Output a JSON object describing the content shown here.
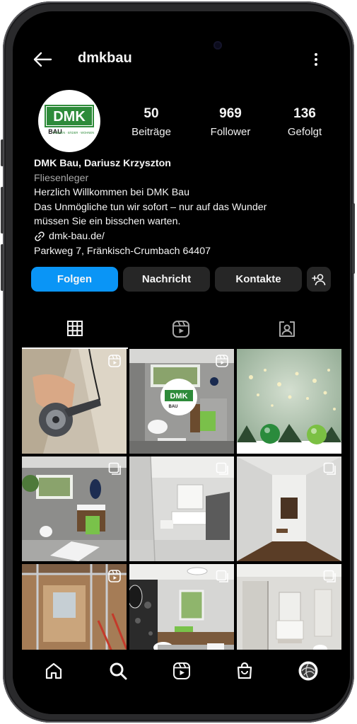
{
  "header": {
    "username": "dmkbau"
  },
  "avatar": {
    "logo_text": "DMK",
    "logo_subtext": "BAU",
    "logo_tagline": "FLIESEN · BÄDER · WOHNEN",
    "brand_color": "#2e8b3a"
  },
  "stats": [
    {
      "value": "50",
      "label": "Beiträge"
    },
    {
      "value": "969",
      "label": "Follower"
    },
    {
      "value": "136",
      "label": "Gefolgt"
    }
  ],
  "bio": {
    "name": "DMK Bau, Dariusz Krzyszton",
    "category": "Fliesenleger",
    "line1": "Herzlich Willkommen bei DMK Bau",
    "line2": "Das Unmögliche tun wir sofort – nur auf das Wunder",
    "line3": "müssen Sie ein bisschen warten.",
    "link": "dmk-bau.de/",
    "address": "Parkweg 7, Fränkisch-Crumbach 64407"
  },
  "buttons": {
    "follow": "Folgen",
    "message": "Nachricht",
    "contacts": "Kontakte",
    "suggest_icon": "add-person-icon"
  },
  "tabs": [
    {
      "icon": "grid-icon",
      "active": true
    },
    {
      "icon": "reels-icon",
      "active": false
    },
    {
      "icon": "tagged-icon",
      "active": false
    }
  ],
  "posts": [
    {
      "subject": "tile cutting with grinder",
      "badge": "reels-icon"
    },
    {
      "subject": "bathroom with DMK BAU logo",
      "badge": "reels-icon"
    },
    {
      "subject": "christmas ornaments",
      "badge": ""
    },
    {
      "subject": "grey bathroom with vanity",
      "badge": "carousel-icon"
    },
    {
      "subject": "white bathroom with double sink",
      "badge": "carousel-icon"
    },
    {
      "subject": "hallway with wooden floor",
      "badge": "carousel-icon"
    },
    {
      "subject": "bathroom renovation drywall",
      "badge": "reels-icon"
    },
    {
      "subject": "bathroom with dark accent wall",
      "badge": "carousel-icon"
    },
    {
      "subject": "walk-in shower bathroom",
      "badge": "carousel-icon"
    }
  ],
  "bottom_nav": [
    "home-icon",
    "search-icon",
    "reels-icon",
    "shop-icon",
    "profile-icon"
  ],
  "colors": {
    "background": "#000000",
    "primary_button": "#0a95f6",
    "secondary_button": "#262626",
    "muted_text": "#a8a8a8"
  }
}
